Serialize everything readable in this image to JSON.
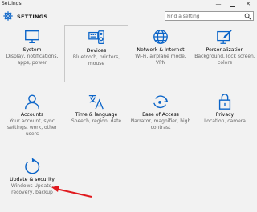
{
  "window": {
    "title": "Settings",
    "minimize": "—",
    "close": "✕"
  },
  "header": {
    "title": "SETTINGS",
    "search_placeholder": "Find a setting"
  },
  "tiles": [
    {
      "name": "System",
      "desc": "Display, notifications, apps, power",
      "icon": "monitor-icon"
    },
    {
      "name": "Devices",
      "desc": "Bluetooth, printers, mouse",
      "icon": "devices-icon"
    },
    {
      "name": "Network & Internet",
      "desc": "Wi-Fi, airplane mode, VPN",
      "icon": "globe-icon"
    },
    {
      "name": "Personalization",
      "desc": "Background, lock screen, colors",
      "icon": "personalization-icon"
    },
    {
      "name": "Accounts",
      "desc": "Your account, sync settings, work, other users",
      "icon": "person-icon"
    },
    {
      "name": "Time & language",
      "desc": "Speech, region, date",
      "icon": "time-language-icon"
    },
    {
      "name": "Ease of Access",
      "desc": "Narrator, magnifier, high contrast",
      "icon": "ease-of-access-icon"
    },
    {
      "name": "Privacy",
      "desc": "Location, camera",
      "icon": "lock-icon"
    },
    {
      "name": "Update & security",
      "desc": "Windows Update, recovery, backup",
      "icon": "refresh-icon"
    }
  ],
  "colors": {
    "accent": "#0a64c8",
    "annotation": "#e0191e"
  }
}
